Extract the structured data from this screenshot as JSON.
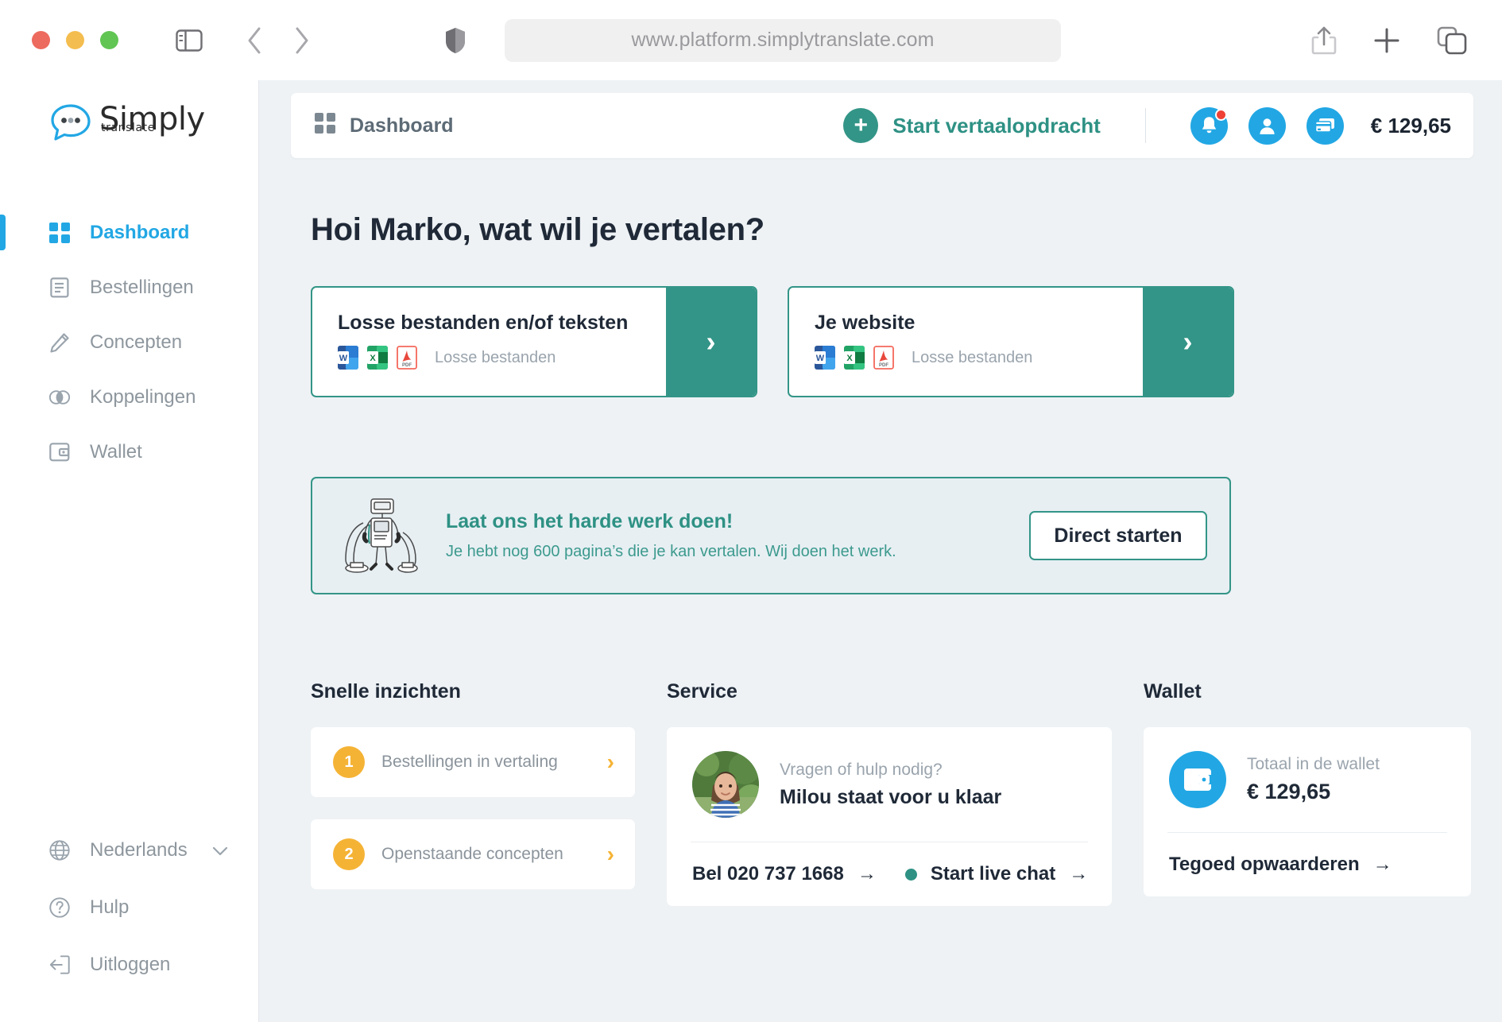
{
  "browser": {
    "url": "www.platform.simplytranslate.com",
    "icons": {
      "sidebar_toggle": "sidebar-toggle-icon",
      "back": "back-arrow-icon",
      "forward": "forward-arrow-icon",
      "shield": "shield-icon",
      "share": "share-icon",
      "new_tab": "plus-icon",
      "tabs": "tabs-overview-icon"
    }
  },
  "sidebar": {
    "logo": {
      "name": "Simply",
      "tagline": "translate"
    },
    "items": [
      {
        "label": "Dashboard",
        "icon": "grid-icon",
        "active": true
      },
      {
        "label": "Bestellingen",
        "icon": "document-icon",
        "active": false
      },
      {
        "label": "Concepten",
        "icon": "pencil-icon",
        "active": false
      },
      {
        "label": "Koppelingen",
        "icon": "link-circles-icon",
        "active": false
      },
      {
        "label": "Wallet",
        "icon": "wallet-icon",
        "active": false
      }
    ],
    "bottom_items": [
      {
        "label": "Nederlands",
        "icon": "globe-icon",
        "chevron": "⌄"
      },
      {
        "label": "Hulp",
        "icon": "question-circle-icon"
      },
      {
        "label": "Uitloggen",
        "icon": "logout-icon"
      }
    ]
  },
  "topbar": {
    "title": "Dashboard",
    "title_icon": "grid-icon",
    "start_button": {
      "label": "Start vertaalopdracht",
      "icon": "plus-icon"
    },
    "notifications_icon": "bell-icon",
    "account_icon": "person-icon",
    "wallet_icon": "credit-card-icon",
    "balance": "€ 129,65"
  },
  "main": {
    "greeting": "Hoi Marko, wat wil je vertalen?",
    "cards": [
      {
        "title": "Losse bestanden en/of teksten",
        "subtext": "Losse bestanden",
        "filetypes": [
          "word-file-icon",
          "excel-file-icon",
          "pdf-file-icon"
        ],
        "arrow": "›"
      },
      {
        "title": "Je website",
        "subtext": "Losse bestanden",
        "filetypes": [
          "word-file-icon",
          "excel-file-icon",
          "pdf-file-icon"
        ],
        "arrow": "›"
      }
    ],
    "promo": {
      "illustration": "robot-illustration",
      "title": "Laat ons het harde werk doen!",
      "subtitle": "Je hebt nog 600 pagina’s die je kan vertalen. Wij doen het werk.",
      "button": "Direct starten"
    },
    "quick": {
      "title": "Snelle inzichten",
      "items": [
        {
          "count": "1",
          "label": "Bestellingen in vertaling",
          "chevron": "›"
        },
        {
          "count": "2",
          "label": "Openstaande concepten",
          "chevron": "›"
        }
      ]
    },
    "service": {
      "title": "Service",
      "avatar": "agent-photo",
      "question": "Vragen of hulp nodig?",
      "agent": "Milou staat voor u klaar",
      "phone_label": "Bel 020 737 1668",
      "phone_arrow": "→",
      "chat_label": "Start live chat",
      "chat_arrow": "→"
    },
    "wallet": {
      "title": "Wallet",
      "icon": "wallet-icon",
      "total_label": "Totaal in de wallet",
      "total_amount": "€ 129,65",
      "topup_label": "Tegoed opwaarderen",
      "topup_arrow": "→"
    }
  },
  "colors": {
    "brand_blue": "#22a7e4",
    "brand_teal": "#339587",
    "accent_orange": "#f5b335",
    "badge_red": "#ef4136",
    "app_bg": "#eef2f5"
  }
}
